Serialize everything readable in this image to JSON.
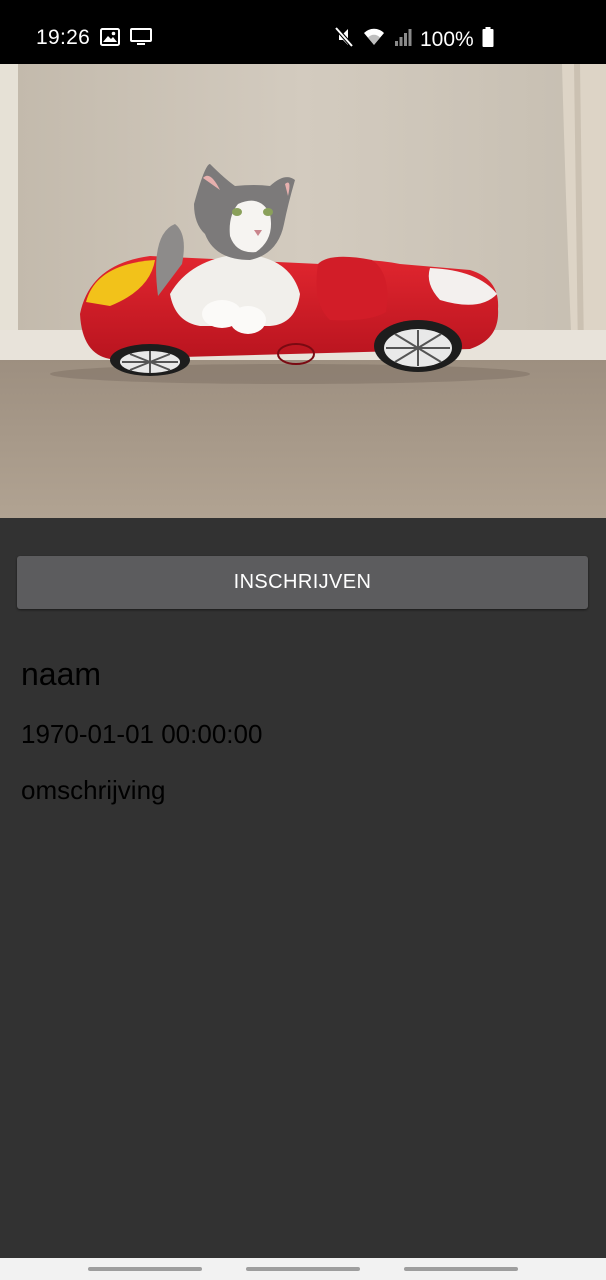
{
  "status_bar": {
    "time": "19:26",
    "battery": "100%",
    "icons_left": [
      "image-icon",
      "cast-screen-icon"
    ],
    "icons_right": [
      "mute-icon",
      "wifi-icon",
      "signal-icon",
      "battery-icon"
    ]
  },
  "hero_image": {
    "subject": "photo-cat-in-car-bed"
  },
  "actions": {
    "subscribe_label": "INSCHRIJVEN"
  },
  "event": {
    "name": "naam",
    "datetime": "1970-01-01 00:00:00",
    "description": "omschrijving"
  },
  "navigation": {
    "buttons": [
      "recents-button",
      "home-button",
      "back-button"
    ]
  },
  "colors": {
    "background": "#323232",
    "button": "#5c5c5e",
    "status_bar": "#000000"
  }
}
